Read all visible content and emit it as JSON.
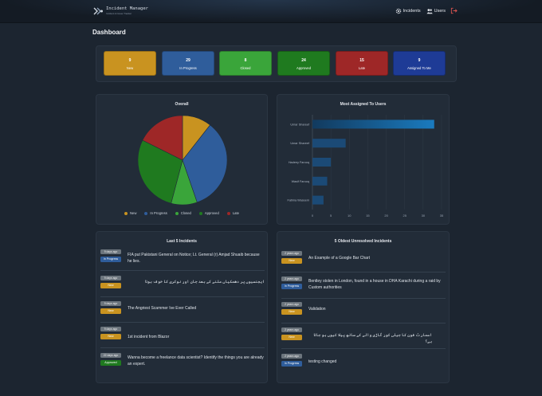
{
  "brand": {
    "title": "Incident Manager",
    "subtitle": "Incident & Issue Tracker"
  },
  "nav": {
    "incidents": "Incidents",
    "users": "Users"
  },
  "page_title": "Dashboard",
  "colors": {
    "new": "#c99320",
    "in_progress": "#2f5d9b",
    "closed": "#3aa53a",
    "approved": "#1f7a1f",
    "late": "#9e2727",
    "assigned": "#1e3b96"
  },
  "stats": [
    {
      "count": "9",
      "label": "New"
    },
    {
      "count": "29",
      "label": "In Progress"
    },
    {
      "count": "8",
      "label": "Closed"
    },
    {
      "count": "24",
      "label": "Approved"
    },
    {
      "count": "15",
      "label": "Late"
    },
    {
      "count": "9",
      "label": "Assigned To Me"
    }
  ],
  "overall": {
    "title": "Overall",
    "legend": [
      "New",
      "In Progress",
      "Closed",
      "Approved",
      "Late"
    ]
  },
  "most_assigned": {
    "title": "Most Assigned To Users"
  },
  "chart_data": [
    {
      "type": "pie",
      "title": "Overall",
      "categories": [
        "New",
        "In Progress",
        "Closed",
        "Approved",
        "Late"
      ],
      "values": [
        9,
        29,
        8,
        24,
        15
      ]
    },
    {
      "type": "bar",
      "orientation": "horizontal",
      "title": "Most Assigned To Users",
      "categories": [
        "Umar Shareef",
        "Umar Shareef",
        "Hadeey Farooq",
        "Wasif Farooq",
        "Fatima Waseem"
      ],
      "values": [
        33,
        9,
        5,
        4,
        3
      ],
      "xlim": [
        0,
        35
      ],
      "xticks": [
        "0",
        "5",
        "10",
        "15",
        "20",
        "25",
        "30",
        "35"
      ]
    }
  ],
  "last5": {
    "title": "Last 5 Incidents",
    "items": [
      {
        "age": "9 days ago",
        "status": "In Progress",
        "title": "FIA put Pakistani General on Notice; Lt. General (r) Amjad Shuaib because he lies."
      },
      {
        "age": "9 days ago",
        "status": "New",
        "title": "ایجنسیوں پر دھمکیاں ملنے کے بعد جان اور نوکری کا خوف ہوتا"
      },
      {
        "age": "9 days ago",
        "status": "New",
        "title": "The Angriest Scammer Ive Ever Called"
      },
      {
        "age": "9 days ago",
        "status": "New",
        "title": "1st incident from Blazor"
      },
      {
        "age": "22 days ago",
        "status": "Approved",
        "title": "Wanna become a freelance data scientist? Identify the things you are already an expert."
      }
    ]
  },
  "oldest": {
    "title": "5 Oldest Unresolved Incidents",
    "items": [
      {
        "age": "2 years ago",
        "status": "New",
        "title": "An Example of a Google Bar Chart"
      },
      {
        "age": "2 years ago",
        "status": "In Progress",
        "title": "Bentley stolen in London, found in a house in DHA Karachi during a raid by Custom authorities"
      },
      {
        "age": "2 years ago",
        "status": "New",
        "title": "Validation"
      },
      {
        "age": "2 years ago",
        "status": "New",
        "title": "اسمارٹ فون کا جیلی کور گاڑی والے کے ساتھ پیلا کیوں ہو جاتا ہے؟"
      },
      {
        "age": "2 years ago",
        "status": "In Progress",
        "title": "testing changed"
      }
    ]
  }
}
